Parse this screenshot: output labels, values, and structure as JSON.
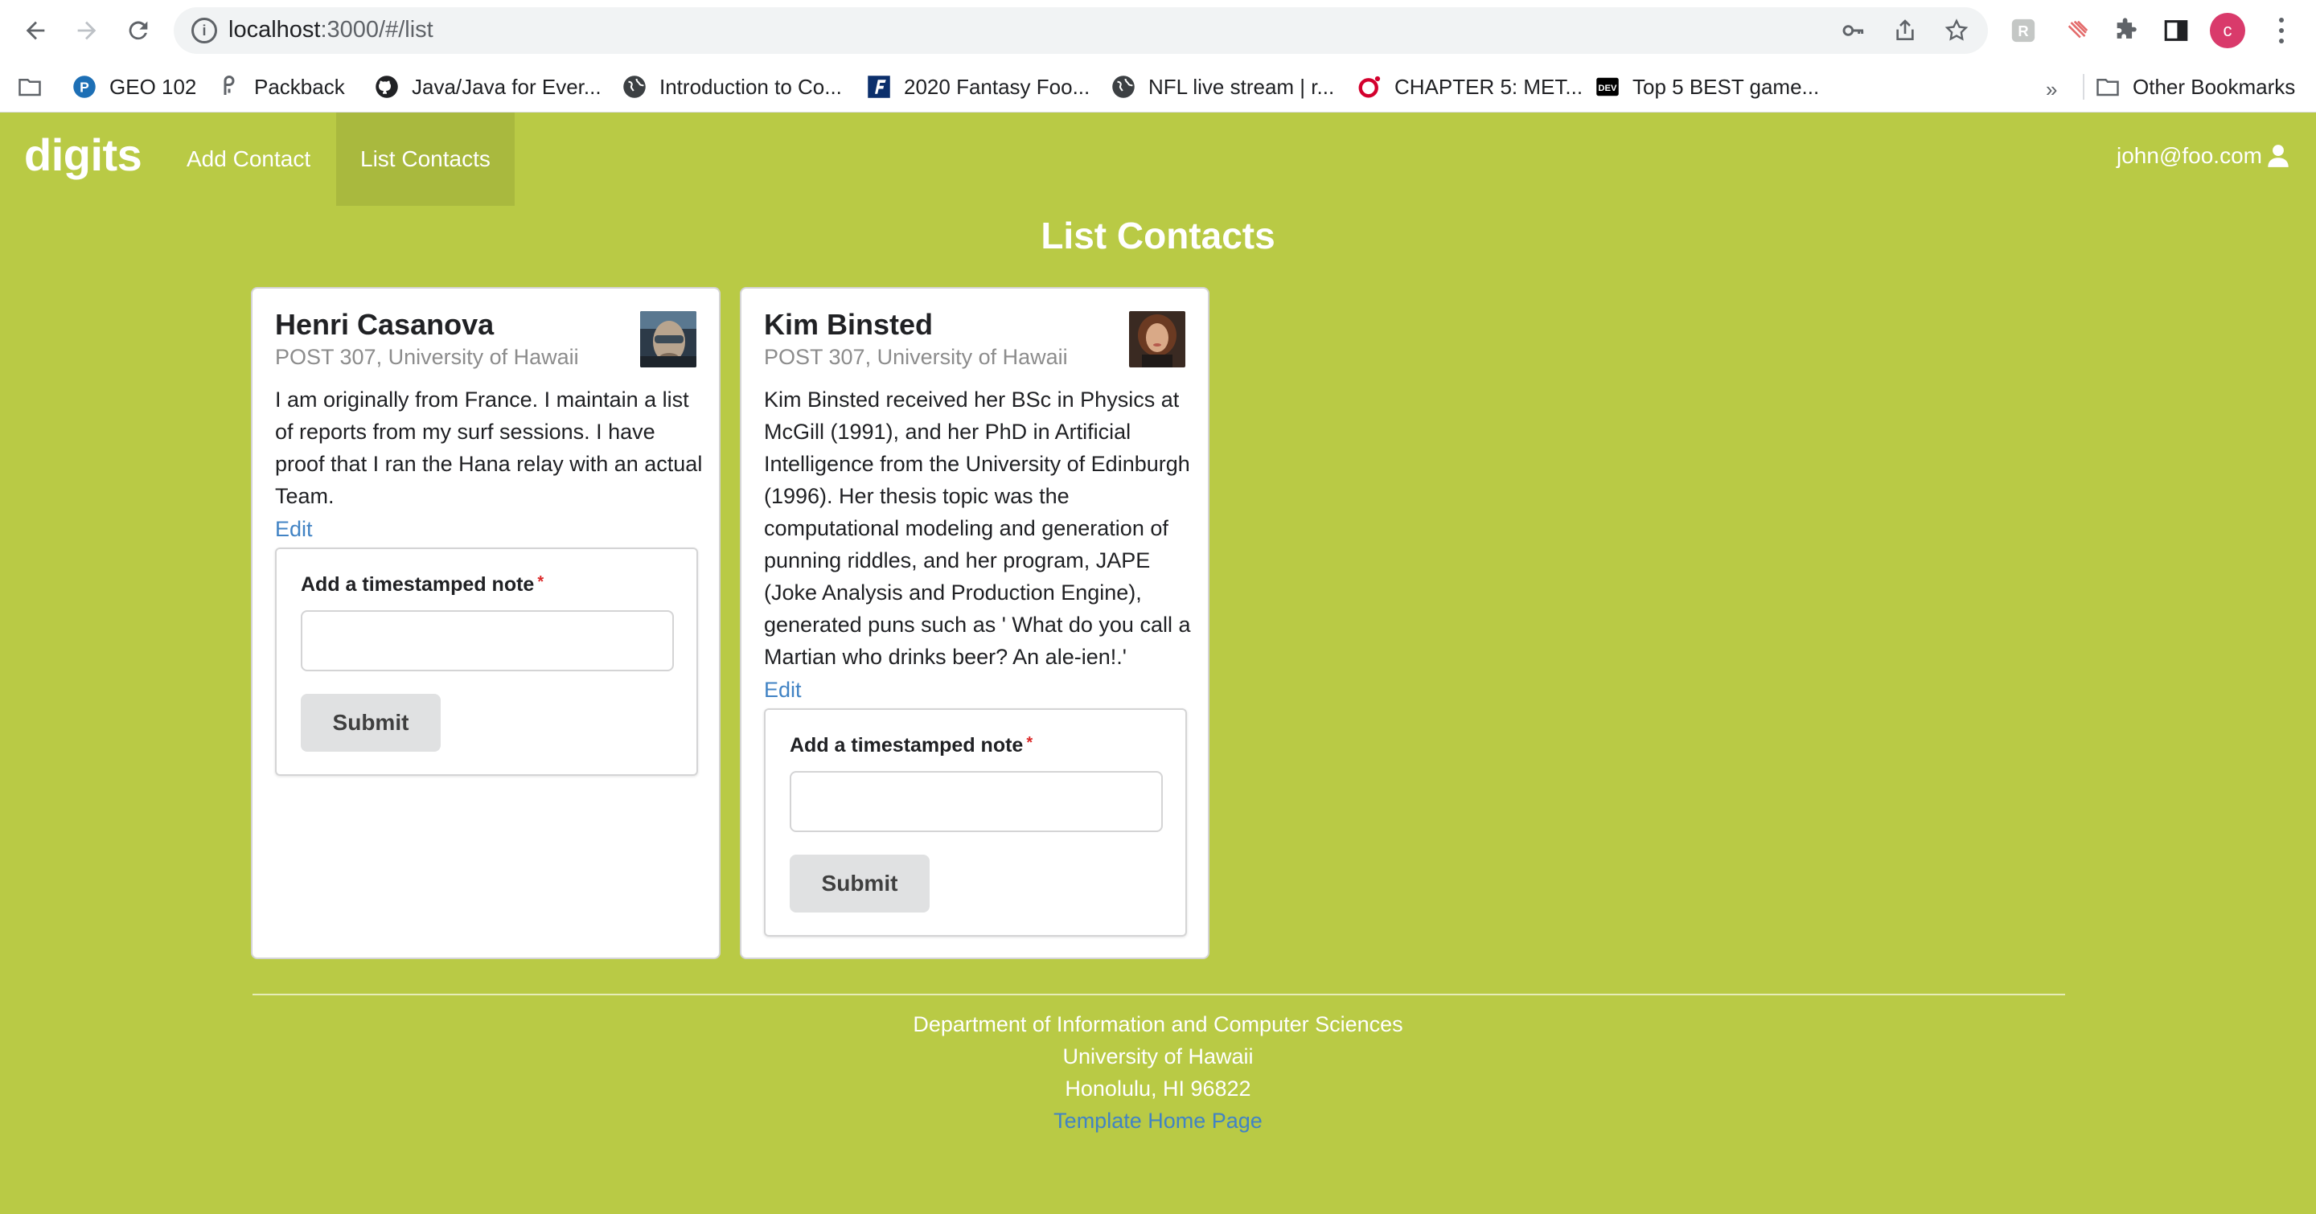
{
  "browser": {
    "url_host": "localhost",
    "url_rest": ":3000/#/list",
    "profile_initial": "c",
    "bookmarks": [
      {
        "label": "GEO 102",
        "icon": "pearson-icon"
      },
      {
        "label": "Packback",
        "icon": "packback-icon"
      },
      {
        "label": "Java/Java for Ever...",
        "icon": "github-icon"
      },
      {
        "label": "Introduction to Co...",
        "icon": "globe-icon"
      },
      {
        "label": "2020 Fantasy Foo...",
        "icon": "fantasy-icon"
      },
      {
        "label": "NFL live stream | r...",
        "icon": "globe-icon"
      },
      {
        "label": "CHAPTER 5: MET...",
        "icon": "oreilly-icon"
      },
      {
        "label": "Top 5 BEST game...",
        "icon": "dev-icon"
      }
    ],
    "overflow": "»",
    "other_bookmarks": "Other Bookmarks"
  },
  "nav": {
    "brand": "digits",
    "add_contact": "Add Contact",
    "list_contacts": "List Contacts",
    "user": "john@foo.com"
  },
  "page": {
    "title": "List Contacts"
  },
  "contacts": [
    {
      "name": "Henri Casanova",
      "address": "POST 307, University of Hawaii",
      "description": "I am originally from France. I maintain a list of reports from my surf sessions. I have proof that I ran the Hana relay with an actual Team.",
      "edit": "Edit",
      "note_label": "Add a timestamped note",
      "required_mark": "*",
      "submit": "Submit"
    },
    {
      "name": "Kim Binsted",
      "address": "POST 307, University of Hawaii",
      "description": "Kim Binsted received her BSc in Physics at McGill (1991), and her PhD in Artificial Intelligence from the University of Edinburgh (1996). Her thesis topic was the computational modeling and generation of punning riddles, and her program, JAPE (Joke Analysis and Production Engine), generated puns such as ' What do you call a Martian who drinks beer? An ale-ien!.'",
      "edit": "Edit",
      "note_label": "Add a timestamped note",
      "required_mark": "*",
      "submit": "Submit"
    }
  ],
  "footer": {
    "line1": "Department of Information and Computer Sciences",
    "line2": "University of Hawaii",
    "line3": "Honolulu, HI 96822",
    "link": "Template Home Page"
  },
  "colors": {
    "page_background": "#b9ca45",
    "active_nav": "#a9b93e",
    "link": "#4183c4",
    "required": "#db2828"
  }
}
